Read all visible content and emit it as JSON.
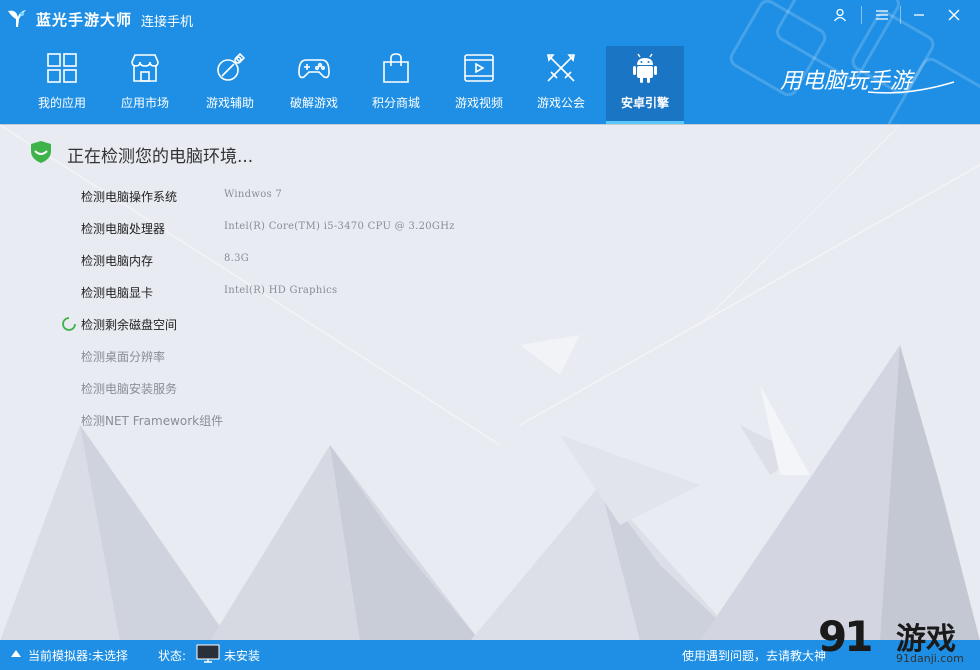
{
  "app": {
    "title": "蓝光手游大师",
    "connect_label": "连接手机",
    "slogan": "用电脑玩手游"
  },
  "tabs": [
    {
      "label": "我的应用",
      "icon": "grid-icon"
    },
    {
      "label": "应用市场",
      "icon": "store-icon"
    },
    {
      "label": "游戏辅助",
      "icon": "tools-icon"
    },
    {
      "label": "破解游戏",
      "icon": "gamepad-icon"
    },
    {
      "label": "积分商城",
      "icon": "shopping-bag-icon"
    },
    {
      "label": "游戏视频",
      "icon": "video-icon"
    },
    {
      "label": "游戏公会",
      "icon": "crossed-swords-icon"
    },
    {
      "label": "安卓引擎",
      "icon": "android-icon",
      "active": true
    }
  ],
  "check": {
    "title": "正在检测您的电脑环境...",
    "items": [
      {
        "label": "检测电脑操作系统",
        "value": "Windwos 7",
        "status": "done"
      },
      {
        "label": "检测电脑处理器",
        "value": "Intel(R) Core(TM) i5-3470 CPU @ 3.20GHz",
        "status": "done"
      },
      {
        "label": "检测电脑内存",
        "value": "8.3G",
        "status": "done"
      },
      {
        "label": "检测电脑显卡",
        "value": "Intel(R) HD Graphics",
        "status": "done"
      },
      {
        "label": "检测剩余磁盘空间",
        "value": "",
        "status": "in-progress"
      },
      {
        "label": "检测桌面分辨率",
        "value": "",
        "status": "pending"
      },
      {
        "label": "检测电脑安装服务",
        "value": "",
        "status": "pending"
      },
      {
        "label": "检测NET Framework组件",
        "value": "",
        "status": "pending"
      }
    ]
  },
  "footer": {
    "emulator_label": "当前模拟器:未选择",
    "status_prefix": "状态:",
    "status_value": "未安装",
    "help_text": "使用遇到问题，去请教大神"
  },
  "watermark": {
    "logo_number": "91",
    "logo_text": "游戏",
    "url": "91danji.com"
  },
  "colors": {
    "header_bg": "#1e8fe4",
    "tab_active_bg": "#1a75c4",
    "main_bg": "#e9ebf2",
    "accent_green": "#3db34a"
  }
}
